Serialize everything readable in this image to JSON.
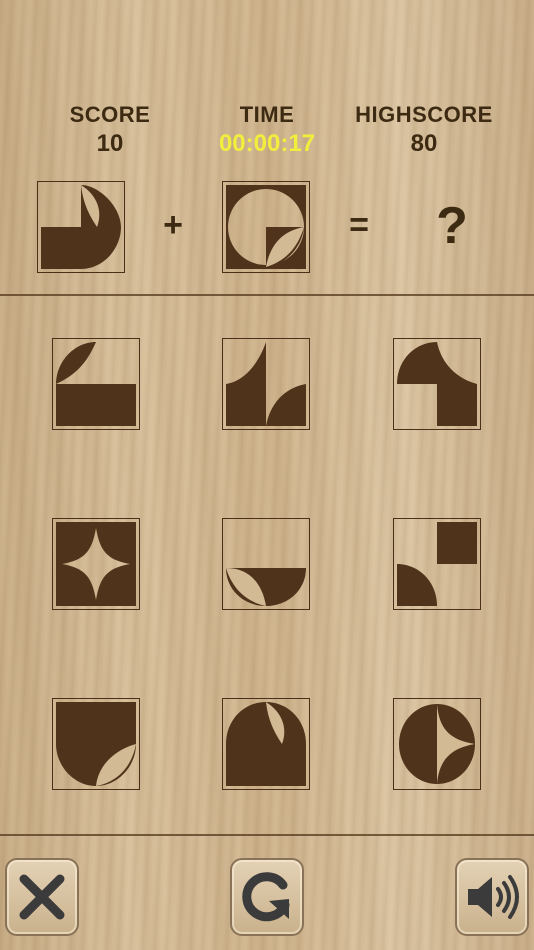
{
  "header": {
    "score_label": "SCORE",
    "score_value": "10",
    "time_label": "TIME",
    "time_value": "00:00:17",
    "highscore_label": "HIGHSCORE",
    "highscore_value": "80"
  },
  "equation": {
    "plus": "+",
    "equals": "=",
    "question": "?"
  },
  "colors": {
    "piece": "#4f331a",
    "time_text": "#f2ef3c",
    "label_text": "#3d2a12"
  },
  "options": [
    "top-left leaf, bottom half",
    "top-center leaf, bottom-left square, bottom-right leaf",
    "top-left quarter disc, right column",
    "four-point star cutout",
    "bottom half bowl with leaf cutout",
    "top-right square, bottom-left quarter disc",
    "top half with bottom leaf cutout",
    "top half disc, bottom half",
    "circle with quarter star cutout"
  ],
  "buttons": {
    "close": "close-icon",
    "restart": "restart-icon",
    "sound": "speaker-icon"
  }
}
